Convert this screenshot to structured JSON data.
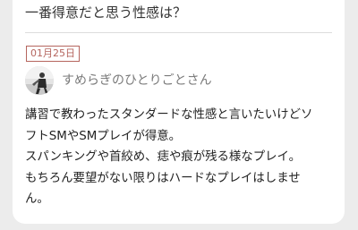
{
  "question": {
    "text": "一番得意だと思う性感は？"
  },
  "entry": {
    "date": "01月25日",
    "author": "すめらぎのひとりごとさん",
    "answer_lines": [
      "講習で教わったスタンダードな性感と言いたいけどソ",
      "フトSMやSMプレイが得意。",
      "スパンキングや首絞め、痣や痕が残る様なプレイ。",
      "もちろん要望がない限りはハードなプレイはしませ",
      "ん。"
    ]
  },
  "colors": {
    "badge": "#b5655e",
    "background": "#ececec",
    "card": "#ffffff"
  }
}
